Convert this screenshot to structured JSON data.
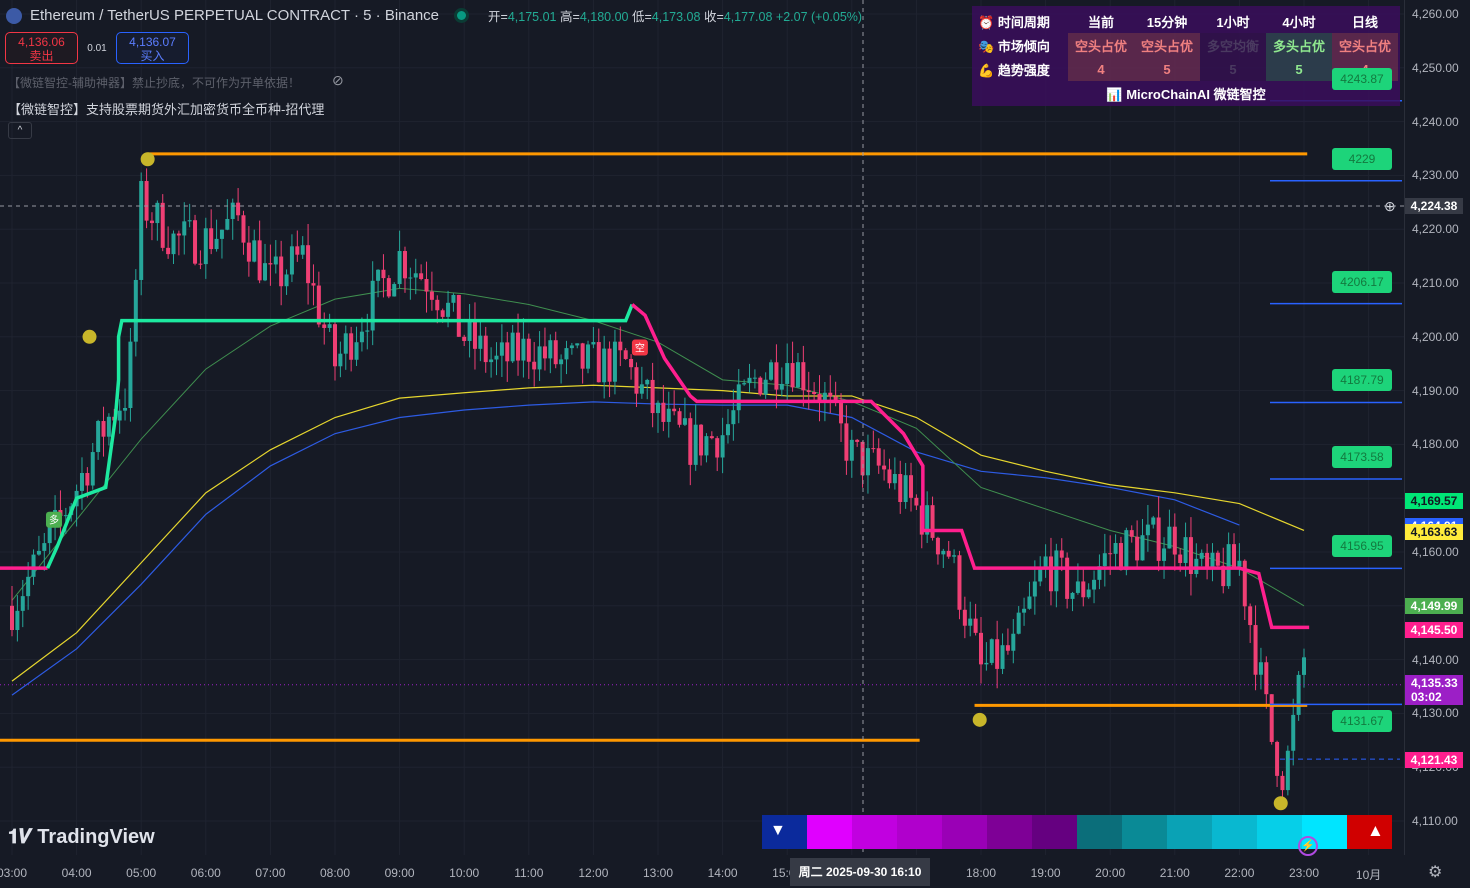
{
  "header": {
    "symbol": "Ethereum / TetherUS PERPETUAL CONTRACT · 5 · Binance",
    "open_label": "开=",
    "open": "4,175.01",
    "high_label": "高=",
    "high": "4,180.00",
    "low_label": "低=",
    "low": "4,173.08",
    "close_label": "收=",
    "close": "4,177.08",
    "change": "+2.07 (+0.05%)"
  },
  "trade": {
    "sell_price": "4,136.06",
    "sell_label": "卖出",
    "spread": "0.01",
    "buy_price": "4,136.07",
    "buy_label": "买入"
  },
  "indicators": {
    "line1": "【微链智控-辅助神器】禁止抄底，不可作为开单依据！",
    "line2": "【微链智控】支持股票期货外汇加密货币全币种-招代理",
    "collapse": "^"
  },
  "panel": {
    "headers": [
      "时间周期",
      "当前",
      "15分钟",
      "1小时",
      "4小时",
      "日线"
    ],
    "trend_label": "市场倾向",
    "trend": [
      "空头占优",
      "空头占优",
      "多空均衡",
      "多头占优",
      "空头占优"
    ],
    "strength_label": "趋势强度",
    "strength": [
      "4",
      "5",
      "5",
      "5",
      "4"
    ],
    "brand": "MicroChainAI 微链智控"
  },
  "axis": {
    "prices": [
      "4,260.00",
      "4,250.00",
      "4,240.00",
      "4,230.00",
      "4,220.00",
      "4,210.00",
      "4,200.00",
      "4,190.00",
      "4,180.00",
      "4,170.00",
      "4,160.00",
      "4,150.00",
      "4,140.00",
      "4,130.00",
      "4,120.00",
      "4,110.00"
    ],
    "crosshair_price": "4,224.38",
    "tags": [
      {
        "text": "4,169.57",
        "bg": "#00e676",
        "fg": "#131722",
        "p": 4169.57
      },
      {
        "text": "4,164.91",
        "bg": "#2962ff",
        "fg": "#ffffff",
        "p": 4164.91
      },
      {
        "text": "4,163.63",
        "bg": "#ffeb3b",
        "fg": "#131722",
        "p": 4163.63
      },
      {
        "text": "4,149.99",
        "bg": "#4caf50",
        "fg": "#ffffff",
        "p": 4149.99
      },
      {
        "text": "4,145.50",
        "bg": "#ff1f8e",
        "fg": "#ffffff",
        "p": 4145.5
      },
      {
        "text": "4,121.43",
        "bg": "#ff1f8e",
        "fg": "#ffffff",
        "p": 4121.43
      }
    ],
    "last_price": "4,135.33",
    "countdown": "03:02"
  },
  "time": {
    "labels": [
      "03:00",
      "04:00",
      "05:00",
      "06:00",
      "07:00",
      "08:00",
      "09:00",
      "10:00",
      "11:00",
      "12:00",
      "13:00",
      "14:00",
      "15:00",
      "18:00",
      "19:00",
      "20:00",
      "21:00",
      "22:00",
      "23:00",
      "10月"
    ],
    "crosshair": "周二 2025-09-30   16:10"
  },
  "brand": "TradingView",
  "chart_data": {
    "type": "candlestick",
    "ylim": [
      4105,
      4262
    ],
    "x_start": "03:00",
    "x_unit": "hours",
    "last_price": 4135.33,
    "price_anchors": [
      [
        0,
        4150
      ],
      [
        0.5,
        4160
      ],
      [
        1,
        4172
      ],
      [
        1.5,
        4185
      ],
      [
        1.8,
        4190
      ],
      [
        2,
        4225
      ],
      [
        2.5,
        4218
      ],
      [
        3,
        4218
      ],
      [
        3.5,
        4222
      ],
      [
        4,
        4210
      ],
      [
        4.5,
        4215
      ],
      [
        5,
        4195
      ],
      [
        5.5,
        4205
      ],
      [
        6,
        4215
      ],
      [
        6.5,
        4210
      ],
      [
        7,
        4200
      ],
      [
        7.5,
        4195
      ],
      [
        8,
        4198
      ],
      [
        8.5,
        4195
      ],
      [
        9,
        4195
      ],
      [
        9.5,
        4195
      ],
      [
        10,
        4185
      ],
      [
        10.5,
        4180
      ],
      [
        11,
        4182
      ],
      [
        11.5,
        4192
      ],
      [
        12,
        4196
      ],
      [
        12.5,
        4190
      ],
      [
        13,
        4178
      ],
      [
        13.5,
        4175
      ],
      [
        14,
        4168
      ],
      [
        14.5,
        4160
      ],
      [
        15,
        4138
      ],
      [
        15.5,
        4142
      ],
      [
        16,
        4158
      ],
      [
        16.5,
        4152
      ],
      [
        17,
        4160
      ],
      [
        17.5,
        4162
      ],
      [
        18,
        4163
      ],
      [
        18.5,
        4155
      ],
      [
        19,
        4158
      ],
      [
        19.5,
        4125
      ],
      [
        19.7,
        4118
      ],
      [
        20,
        4140
      ],
      [
        20.08,
        4135
      ]
    ],
    "ma_green": [
      4151,
      4166,
      4181,
      4194,
      4202,
      4207,
      4209,
      4208,
      4206,
      4203,
      4199,
      4192,
      4191,
      4188,
      4183,
      4172,
      4168,
      4164,
      4161,
      4157,
      4150
    ],
    "ma_yellow": [
      4136,
      4145,
      4158,
      4171,
      4179,
      4185,
      4188.6,
      4189.6,
      4190.5,
      4191,
      4190.5,
      4190,
      4189,
      4189,
      4185,
      4178,
      4175,
      4172.5,
      4171,
      4169,
      4164
    ],
    "ma_blue": [
      4133.4,
      4142,
      4154,
      4167,
      4176,
      4182,
      4185,
      4186.4,
      4187.3,
      4187.9,
      4187.5,
      4187.3,
      4187.3,
      4185,
      4178.6,
      4175,
      4173.8,
      4172,
      4169.7,
      4165
    ],
    "supertrend_bear_1": [
      [
        -0.2,
        4157
      ],
      [
        0.55,
        4157
      ]
    ],
    "supertrend_bull": [
      [
        0.55,
        4157
      ],
      [
        0.7,
        4161
      ],
      [
        1.0,
        4170
      ],
      [
        1.45,
        4172
      ],
      [
        1.6,
        4185
      ],
      [
        1.65,
        4192
      ],
      [
        1.65,
        4200
      ],
      [
        1.7,
        4203
      ],
      [
        9.5,
        4203
      ],
      [
        9.6,
        4206
      ]
    ],
    "supertrend_bear_2": [
      [
        9.6,
        4206
      ],
      [
        9.8,
        4204
      ],
      [
        10.1,
        4196
      ],
      [
        10.5,
        4189
      ],
      [
        10.6,
        4188
      ],
      [
        13.3,
        4188
      ],
      [
        13.8,
        4182
      ],
      [
        14.1,
        4176
      ],
      [
        14.1,
        4164
      ],
      [
        14.7,
        4164
      ],
      [
        14.9,
        4157
      ],
      [
        19.0,
        4157
      ],
      [
        19.3,
        4156
      ],
      [
        19.5,
        4146
      ],
      [
        20.08,
        4146
      ]
    ],
    "support_lines": [
      {
        "p": 4234,
        "from": 2.1,
        "to": 20.05
      },
      {
        "p": 4125,
        "from": -0.2,
        "to": 14.05
      },
      {
        "p": 4131.5,
        "from": 14.9,
        "to": 20.05
      }
    ],
    "dots": [
      [
        2.1,
        4233
      ],
      [
        1.2,
        4200
      ],
      [
        14.98,
        4128.8
      ],
      [
        19.64,
        4113.3
      ]
    ],
    "targets": [
      "4243.87",
      "4229",
      "4206.17",
      "4187.79",
      "4173.58",
      "4156.95",
      "4131.67"
    ],
    "signals": [
      {
        "h": 0.65,
        "p": 4166,
        "text": "多",
        "color": "#4caf50"
      },
      {
        "h": 9.72,
        "p": 4198,
        "text": "空",
        "color": "#f23645"
      }
    ],
    "strip_colors": [
      "#0b2a9c",
      "#e000ff",
      "#c100e0",
      "#b000cc",
      "#9a00b6",
      "#7e0096",
      "#650080",
      "#0b6e7a",
      "#0a8a96",
      "#0aa2b5",
      "#09b8d0",
      "#06cfe8",
      "#00e5ff",
      "#d00000"
    ]
  }
}
